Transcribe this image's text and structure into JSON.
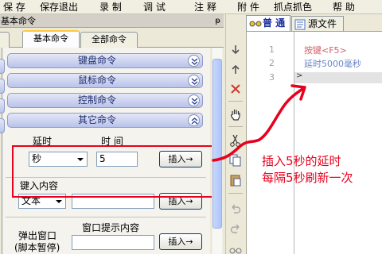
{
  "menubar": {
    "items": [
      "保 存",
      "保存退出",
      "录 制",
      "调 试",
      "注 释",
      "附 件",
      "抓点抓色",
      "帮 助"
    ]
  },
  "left_panel": {
    "title": "基本命令",
    "pin": "ᵽ",
    "tabs": [
      {
        "label": "",
        "active": false
      },
      {
        "label": "基本命令",
        "active": true
      },
      {
        "label": "全部命令",
        "active": false
      }
    ],
    "groups": [
      {
        "label": "键盘命令",
        "expanded": false
      },
      {
        "label": "鼠标命令",
        "expanded": false
      },
      {
        "label": "控制命令",
        "expanded": false
      },
      {
        "label": "其它命令",
        "expanded": true
      }
    ],
    "delay": {
      "label_delay": "延时",
      "label_time": "时 间",
      "unit_value": "秒",
      "time_value": "5",
      "insert_label": "插入→"
    },
    "key_input": {
      "label": "键入内容",
      "mode_value": "文本",
      "text_value": "",
      "insert_label": "插入→"
    },
    "popup": {
      "label_line1": "弹出窗口",
      "label_line2": "(脚本暂停)",
      "hint_label": "窗口提示内容",
      "insert_label": "插入→"
    }
  },
  "editor": {
    "tabs": [
      {
        "label": "普 通",
        "active": true,
        "icon": "glasses-icon"
      },
      {
        "label": "源文件",
        "active": false,
        "icon": "document-icon"
      }
    ],
    "lines": [
      {
        "num": "1",
        "text": "按键<F5>",
        "color": "#d05f6a"
      },
      {
        "num": "2",
        "text": "延时5000毫秒",
        "color": "#6a86c8"
      },
      {
        "num": "3",
        "text": "",
        "color": "#000000"
      }
    ]
  },
  "annotation": {
    "line1": "插入5秒的延时",
    "line2": "每隔5秒刷新一次",
    "color": "#e8001c"
  }
}
